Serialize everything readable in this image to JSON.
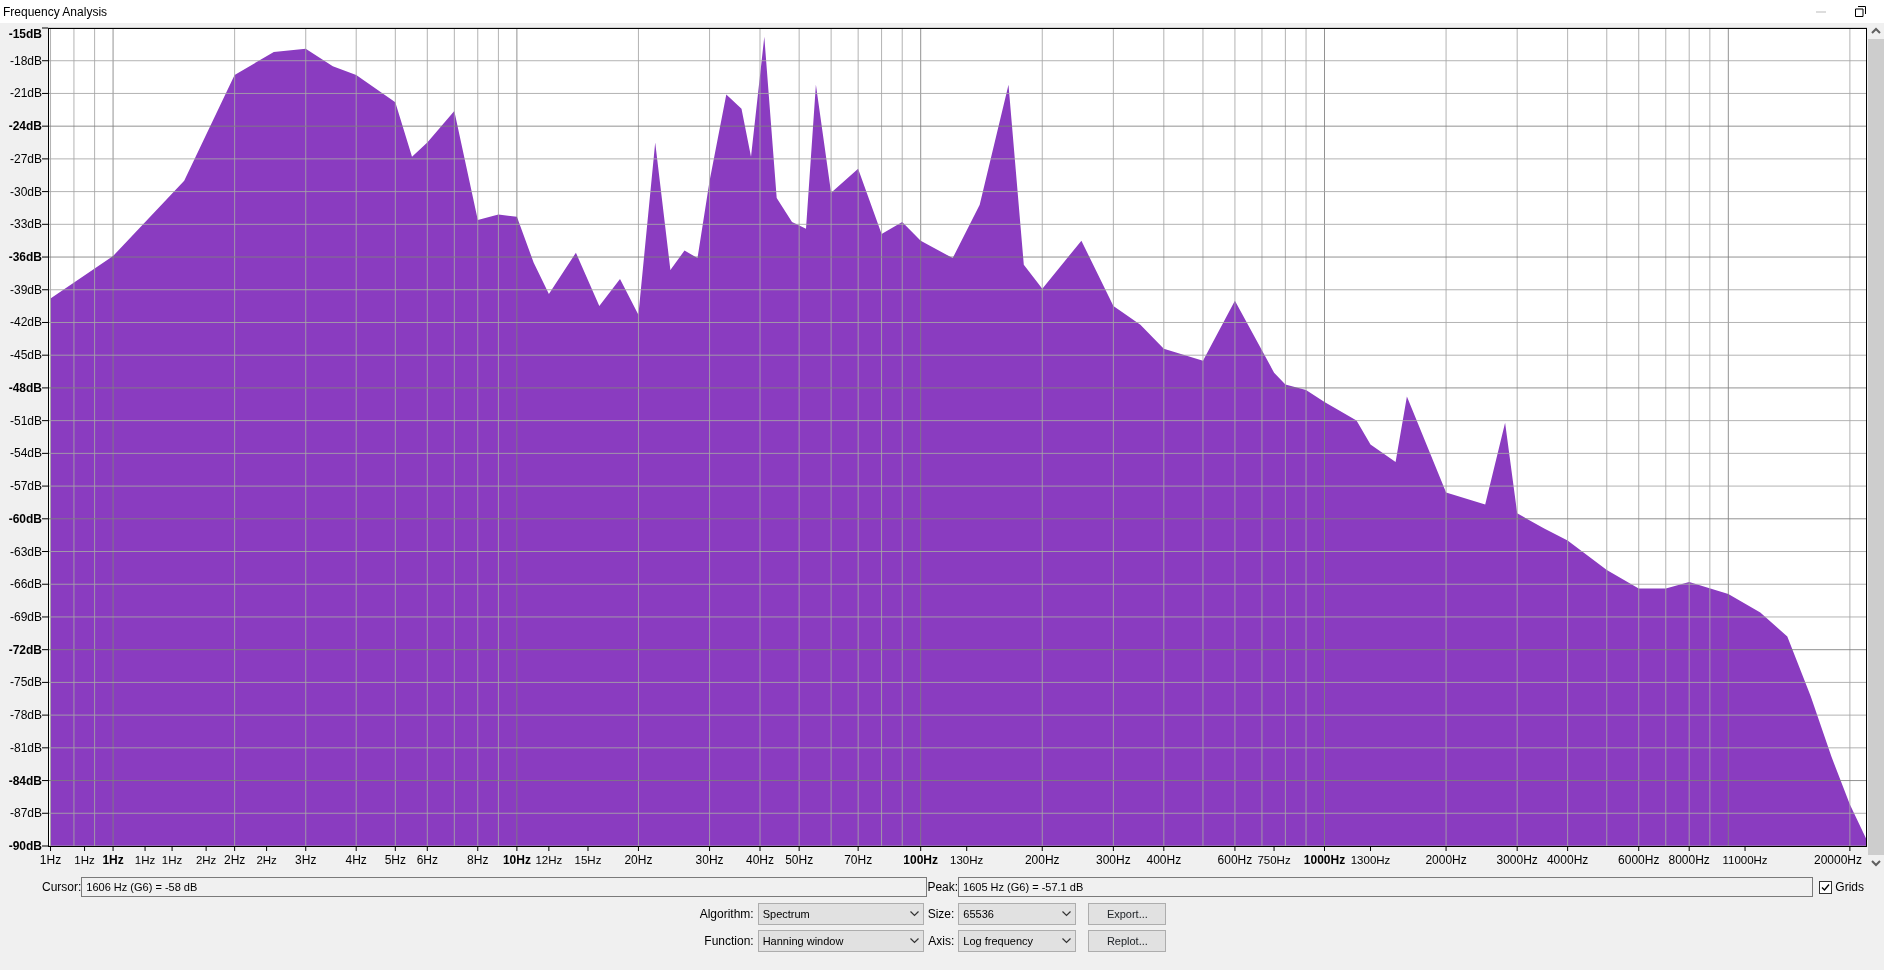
{
  "window": {
    "title": "Frequency Analysis"
  },
  "chart": {
    "y_axis_labels": [
      "-15dB",
      "-18dB",
      "-21dB",
      "-24dB",
      "-27dB",
      "-30dB",
      "-33dB",
      "-36dB",
      "-39dB",
      "-42dB",
      "-45dB",
      "-48dB",
      "-51dB",
      "-54dB",
      "-57dB",
      "-60dB",
      "-63dB",
      "-66dB",
      "-69dB",
      "-72dB",
      "-75dB",
      "-78dB",
      "-81dB",
      "-84dB",
      "-87dB",
      "-90dB"
    ],
    "x_axis_labels": [
      "1Hz",
      "1Hz",
      "1Hz",
      "1Hz",
      "1Hz",
      "2Hz",
      "2Hz",
      "2Hz",
      "3Hz",
      "4Hz",
      "5Hz",
      "6Hz",
      "8Hz",
      "10Hz",
      "12Hz",
      "15Hz",
      "20Hz",
      "30Hz",
      "40Hz",
      "50Hz",
      "70Hz",
      "100Hz",
      "130Hz",
      "200Hz",
      "300Hz",
      "400Hz",
      "600Hz",
      "750Hz",
      "1000Hz",
      "1300Hz",
      "2000Hz",
      "3000Hz",
      "4000Hz",
      "6000Hz",
      "8000Hz",
      "11000Hz",
      "20000Hz"
    ]
  },
  "cursor": {
    "label": "Cursor:",
    "value": "1606 Hz (G6) = -58 dB"
  },
  "peak": {
    "label": "Peak:",
    "value": "1605 Hz (G6) = -57.1 dB"
  },
  "grids": {
    "label": "Grids",
    "checked": true
  },
  "settings_rows": [
    {
      "fields": [
        {
          "label": "Algorithm:",
          "value": "Spectrum"
        },
        {
          "label": "Size:",
          "value": "65536"
        }
      ],
      "button": "Export..."
    },
    {
      "fields": [
        {
          "label": "Function:",
          "value": "Hanning window"
        },
        {
          "label": "Axis:",
          "value": "Log frequency"
        }
      ],
      "button": "Replot..."
    }
  ]
}
